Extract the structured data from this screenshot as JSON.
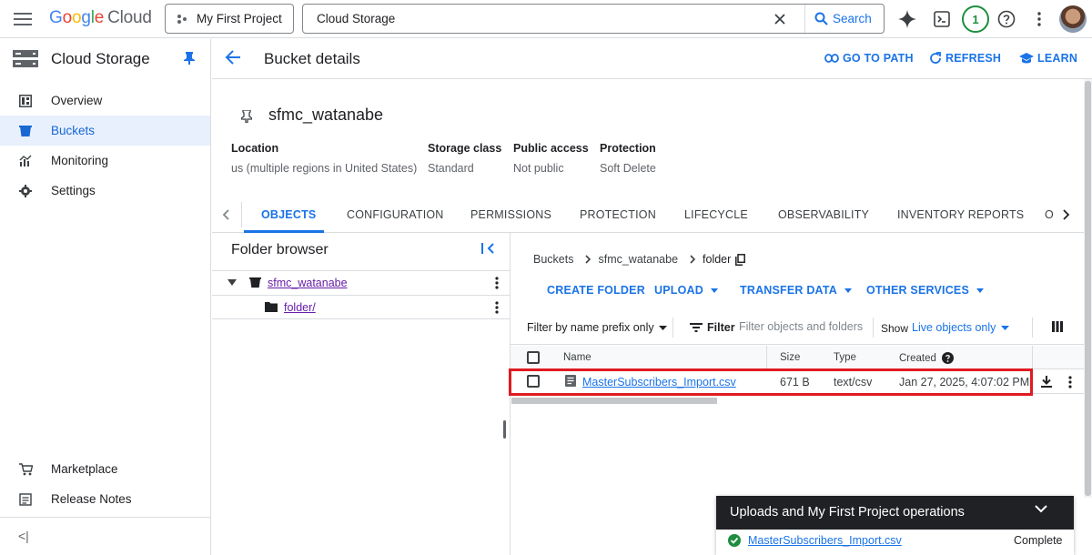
{
  "topbar": {
    "logo_google": [
      "G",
      "o",
      "o",
      "g",
      "l",
      "e"
    ],
    "logo_cloud": "Cloud",
    "project_label": "My First Project",
    "search_value": "Cloud Storage",
    "search_button": "Search",
    "notification_count": "1"
  },
  "sidebar": {
    "product_title": "Cloud Storage",
    "items": [
      {
        "label": "Overview",
        "icon": "dashboard-icon"
      },
      {
        "label": "Buckets",
        "icon": "bucket-icon",
        "active": true
      },
      {
        "label": "Monitoring",
        "icon": "monitoring-icon"
      },
      {
        "label": "Settings",
        "icon": "gear-icon"
      }
    ],
    "bottom_items": [
      {
        "label": "Marketplace",
        "icon": "cart-icon"
      },
      {
        "label": "Release Notes",
        "icon": "release-notes-icon"
      }
    ],
    "collapse_glyph": "<|"
  },
  "header": {
    "title": "Bucket details",
    "actions": {
      "go_to_path": "GO TO PATH",
      "refresh": "REFRESH",
      "learn": "LEARN"
    }
  },
  "bucket": {
    "name": "sfmc_watanabe",
    "meta": {
      "location_label": "Location",
      "location_value": "us (multiple regions in United States)",
      "storage_class_label": "Storage class",
      "storage_class_value": "Standard",
      "public_access_label": "Public access",
      "public_access_value": "Not public",
      "protection_label": "Protection",
      "protection_value": "Soft Delete"
    }
  },
  "tabs": [
    "OBJECTS",
    "CONFIGURATION",
    "PERMISSIONS",
    "PROTECTION",
    "LIFECYCLE",
    "OBSERVABILITY",
    "INVENTORY REPORTS",
    "O"
  ],
  "folder_browser": {
    "title": "Folder browser",
    "bucket": "sfmc_watanabe",
    "folder": "folder/"
  },
  "breadcrumb": {
    "root": "Buckets",
    "bucket": "sfmc_watanabe",
    "current": "folder"
  },
  "actions": {
    "create_folder": "CREATE FOLDER",
    "upload": "UPLOAD",
    "transfer_data": "TRANSFER DATA",
    "other_services": "OTHER SERVICES"
  },
  "filter": {
    "prefix_select": "Filter by name prefix only",
    "filter_label": "Filter",
    "placeholder": "Filter objects and folders",
    "show_label": "Show",
    "show_value": "Live objects only"
  },
  "table": {
    "columns": {
      "name": "Name",
      "size": "Size",
      "type": "Type",
      "created": "Created"
    },
    "rows": [
      {
        "name": "MasterSubscribers_Import.csv",
        "size": "671 B",
        "type": "text/csv",
        "created": "Jan 27, 2025, 4:07:02 PM"
      }
    ]
  },
  "operations": {
    "title": "Uploads and My First Project operations",
    "file": "MasterSubscribers_Import.csv",
    "status": "Complete"
  },
  "colors": {
    "accent": "#1a73e8",
    "highlight": "#e01b22",
    "success": "#1e8e3e",
    "visited_link": "#681da8"
  }
}
